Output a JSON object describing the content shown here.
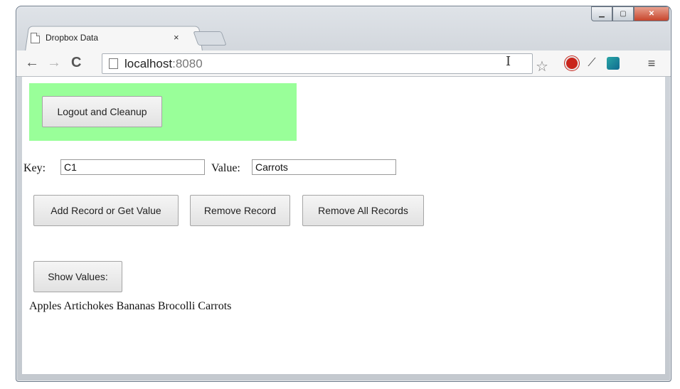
{
  "browser": {
    "tab_title": "Dropbox Data",
    "tab_close": "×",
    "url_host": "localhost",
    "url_port": ":8080",
    "icons": [
      "back-icon",
      "forward-icon",
      "reload-icon",
      "page-icon",
      "star-icon",
      "stop-extension-icon",
      "picker-extension-icon",
      "wave-extension-icon",
      "menu-icon"
    ]
  },
  "page": {
    "logout_label": "Logout and Cleanup",
    "key_label": "Key:",
    "key_value": "C1",
    "value_label": "Value:",
    "value_value": "Carrots",
    "add_label": "Add Record or Get Value",
    "remove_label": "Remove Record",
    "remove_all_label": "Remove All Records",
    "show_label": "Show Values:",
    "values_text": "Apples Artichokes Bananas Brocolli Carrots"
  },
  "colors": {
    "panel_bg": "#99ff99",
    "close_button": "#c7452c"
  }
}
